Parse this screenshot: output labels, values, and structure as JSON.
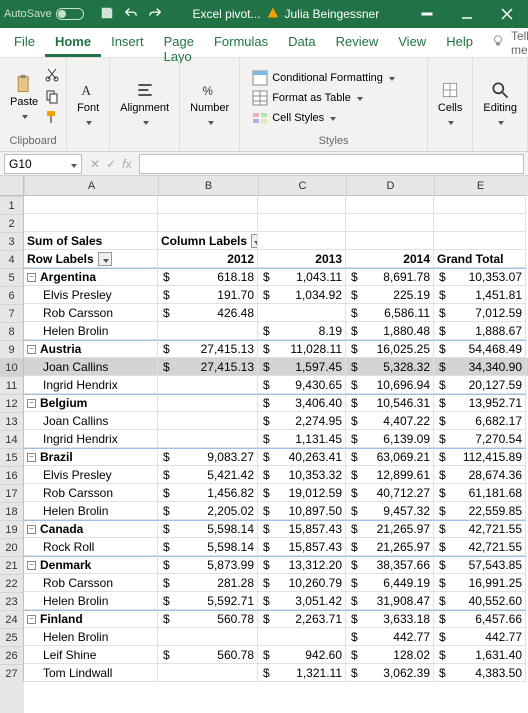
{
  "titlebar": {
    "autosave": "AutoSave",
    "filename": "Excel pivot...",
    "user": "Julia Beingessner"
  },
  "menu": {
    "tabs": [
      "File",
      "Home",
      "Insert",
      "Page Layo",
      "Formulas",
      "Data",
      "Review",
      "View",
      "Help"
    ],
    "active": 1,
    "tellme": "Tell me"
  },
  "ribbon": {
    "paste": "Paste",
    "font": "Font",
    "alignment": "Alignment",
    "number": "Number",
    "cond": "Conditional Formatting",
    "fat": "Format as Table",
    "cellstyles": "Cell Styles",
    "cells": "Cells",
    "editing": "Editing",
    "groups": {
      "clipboard": "Clipboard",
      "styles": "Styles"
    }
  },
  "namebox": "G10",
  "columns": [
    "A",
    "B",
    "C",
    "D",
    "E"
  ],
  "pivot": {
    "sumof": "Sum of Sales",
    "collabels": "Column Labels",
    "rowlabels": "Row Labels",
    "years": [
      "2012",
      "2013",
      "2014"
    ],
    "grandtotal": "Grand Total"
  },
  "rows": [
    {
      "r": 5,
      "type": "country",
      "label": "Argentina",
      "vals": [
        "618.18",
        "1,043.11",
        "8,691.78",
        "10,353.07"
      ]
    },
    {
      "r": 6,
      "type": "person",
      "label": "Elvis Presley",
      "vals": [
        "191.70",
        "1,034.92",
        "225.19",
        "1,451.81"
      ]
    },
    {
      "r": 7,
      "type": "person",
      "label": "Rob Carsson",
      "vals": [
        "426.48",
        "",
        "6,586.11",
        "7,012.59"
      ]
    },
    {
      "r": 8,
      "type": "person",
      "label": "Helen Brolin",
      "vals": [
        "",
        "8.19",
        "1,880.48",
        "1,888.67"
      ]
    },
    {
      "r": 9,
      "type": "country",
      "label": "Austria",
      "vals": [
        "27,415.13",
        "11,028.11",
        "16,025.25",
        "54,468.49"
      ]
    },
    {
      "r": 10,
      "type": "person",
      "label": "Joan Callins",
      "vals": [
        "27,415.13",
        "1,597.45",
        "5,328.32",
        "34,340.90"
      ],
      "sel": true
    },
    {
      "r": 11,
      "type": "person",
      "label": "Ingrid Hendrix",
      "vals": [
        "",
        "9,430.65",
        "10,696.94",
        "20,127.59"
      ]
    },
    {
      "r": 12,
      "type": "country",
      "label": "Belgium",
      "vals": [
        "",
        "3,406.40",
        "10,546.31",
        "13,952.71"
      ]
    },
    {
      "r": 13,
      "type": "person",
      "label": "Joan Callins",
      "vals": [
        "",
        "2,274.95",
        "4,407.22",
        "6,682.17"
      ]
    },
    {
      "r": 14,
      "type": "person",
      "label": "Ingrid Hendrix",
      "vals": [
        "",
        "1,131.45",
        "6,139.09",
        "7,270.54"
      ]
    },
    {
      "r": 15,
      "type": "country",
      "label": "Brazil",
      "vals": [
        "9,083.27",
        "40,263.41",
        "63,069.21",
        "112,415.89"
      ]
    },
    {
      "r": 16,
      "type": "person",
      "label": "Elvis Presley",
      "vals": [
        "5,421.42",
        "10,353.32",
        "12,899.61",
        "28,674.36"
      ]
    },
    {
      "r": 17,
      "type": "person",
      "label": "Rob Carsson",
      "vals": [
        "1,456.82",
        "19,012.59",
        "40,712.27",
        "61,181.68"
      ]
    },
    {
      "r": 18,
      "type": "person",
      "label": "Helen Brolin",
      "vals": [
        "2,205.02",
        "10,897.50",
        "9,457.32",
        "22,559.85"
      ]
    },
    {
      "r": 19,
      "type": "country",
      "label": "Canada",
      "vals": [
        "5,598.14",
        "15,857.43",
        "21,265.97",
        "42,721.55"
      ]
    },
    {
      "r": 20,
      "type": "person",
      "label": "Rock Roll",
      "vals": [
        "5,598.14",
        "15,857.43",
        "21,265.97",
        "42,721.55"
      ]
    },
    {
      "r": 21,
      "type": "country",
      "label": "Denmark",
      "vals": [
        "5,873.99",
        "13,312.20",
        "38,357.66",
        "57,543.85"
      ]
    },
    {
      "r": 22,
      "type": "person",
      "label": "Rob Carsson",
      "vals": [
        "281.28",
        "10,260.79",
        "6,449.19",
        "16,991.25"
      ]
    },
    {
      "r": 23,
      "type": "person",
      "label": "Helen Brolin",
      "vals": [
        "5,592.71",
        "3,051.42",
        "31,908.47",
        "40,552.60"
      ]
    },
    {
      "r": 24,
      "type": "country",
      "label": "Finland",
      "vals": [
        "560.78",
        "2,263.71",
        "3,633.18",
        "6,457.66"
      ]
    },
    {
      "r": 25,
      "type": "person",
      "label": "Helen Brolin",
      "vals": [
        "",
        "",
        "442.77",
        "442.77"
      ]
    },
    {
      "r": 26,
      "type": "person",
      "label": "Leif Shine",
      "vals": [
        "560.78",
        "942.60",
        "128.02",
        "1,631.40"
      ]
    },
    {
      "r": 27,
      "type": "person",
      "label": "Tom Lindwall",
      "vals": [
        "",
        "1,321.11",
        "3,062.39",
        "4,383.50"
      ]
    }
  ]
}
